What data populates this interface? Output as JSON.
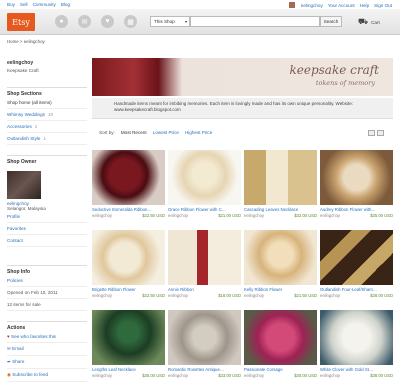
{
  "topnav": [
    "Buy",
    "Sell",
    "Community",
    "Blog"
  ],
  "usernav": {
    "username": "eelingchoy",
    "account": "Your Account",
    "help": "Help",
    "signout": "Sign Out"
  },
  "header": {
    "logo": "Etsy",
    "scope": "This Shop",
    "search_btn": "Search",
    "cart": "Cart"
  },
  "breadcrumb": "Home > eelingchoy",
  "sidebar": {
    "shop_name": "eelingchoy",
    "shop_tagline": "Keepsake Craft",
    "sections_title": "Shop Sections",
    "sections": [
      {
        "label": "Shop home (all items)",
        "count": ""
      },
      {
        "label": "Whimsy Weddings",
        "count": "10"
      },
      {
        "label": "Accessories",
        "count": "1"
      },
      {
        "label": "Outlandish Style",
        "count": "1"
      }
    ],
    "owner_title": "Shop Owner",
    "owner_name": "eelingchoy",
    "owner_loc": "Selangor, Malaysia",
    "owner_links": [
      "Profile",
      "Favorites",
      "Contact"
    ],
    "info_title": "Shop Info",
    "info_links": [
      "Policies"
    ],
    "info_opened": "Opened on Feb 10, 2011",
    "info_sales": "12 items for sale",
    "actions_title": "Actions",
    "actions": [
      "See who favorites this",
      "Email",
      "Share",
      "Subscribe to feed"
    ]
  },
  "banner": {
    "title": "keepsake craft",
    "subtitle": "tokens of memory"
  },
  "description": "Handmade items meant for imbibing memories. Each item is lovingly made and has its own unique personality. Website: www.keepsakecraft.blogspot.com",
  "sort": {
    "label": "Sort by:",
    "options": [
      "Most Recent",
      "Lowest Price",
      "Highest Price"
    ]
  },
  "colors": {
    "brand": "#e5591e",
    "link": "#2a6ebb",
    "price": "#5a8a2f"
  },
  "items": [
    {
      "title": "Seductive Esmeralda Ribbon…",
      "seller": "eelingchoy",
      "price": "$22.50 USD"
    },
    {
      "title": "Grace Ribbon Flower with C…",
      "seller": "eelingchoy",
      "price": "$21.00 USD"
    },
    {
      "title": "Cascading Leaves Necklace",
      "seller": "eelingchoy",
      "price": "$32.00 USD"
    },
    {
      "title": "Audrey Ribbon Flower with…",
      "seller": "eelingchoy",
      "price": "$25.00 USD"
    },
    {
      "title": "Brigette Ribbon Flower",
      "seller": "eelingchoy",
      "price": "$22.50 USD"
    },
    {
      "title": "Annie Ribbon",
      "seller": "eelingchoy",
      "price": "$18.00 USD"
    },
    {
      "title": "Kelly Ribbon Flower",
      "seller": "eelingchoy",
      "price": "$21.50 USD"
    },
    {
      "title": "Outlandish Four-Leaf/Sham…",
      "seller": "eelingchoy",
      "price": "$28.00 USD"
    },
    {
      "title": "Lengths Leaf Necklace",
      "seller": "eelingchoy",
      "price": "$35.00 USD"
    },
    {
      "title": "Romantic Rosettes Antique…",
      "seller": "eelingchoy",
      "price": "$33.00 USD"
    },
    {
      "title": "Passionate Corsage",
      "seller": "eelingchoy",
      "price": "$30.00 USD"
    },
    {
      "title": "White Clover with Gold St…",
      "seller": "eelingchoy",
      "price": "$38.00 USD"
    }
  ]
}
